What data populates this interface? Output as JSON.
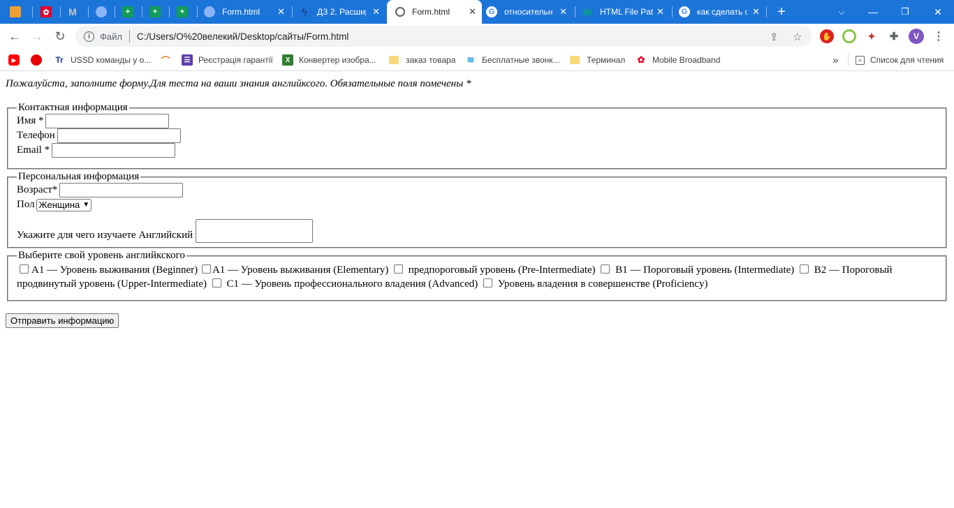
{
  "browser": {
    "tabs": [
      {
        "title": "",
        "icon": "bookmark-favicon",
        "color": "#f0a030",
        "active": false
      },
      {
        "title": "",
        "icon": "huawei-favicon",
        "color": "#e4002b",
        "active": false
      },
      {
        "title": "",
        "icon": "gmail-favicon",
        "color": "#c0c7d6",
        "active": false
      },
      {
        "title": "",
        "icon": "globe-favicon",
        "color": "#8ab4f8",
        "active": false
      },
      {
        "title": "",
        "icon": "plus-green-favicon",
        "color": "#0f9d58",
        "active": false
      },
      {
        "title": "",
        "icon": "plus-green-favicon",
        "color": "#0f9d58",
        "active": false
      },
      {
        "title": "",
        "icon": "plus-green-favicon",
        "color": "#0f9d58",
        "active": false
      },
      {
        "title": "Form.html",
        "icon": "globe-favicon",
        "color": "#8ab4f8",
        "active": false
      },
      {
        "title": "ДЗ 2. Расшир",
        "icon": "lightning-favicon",
        "color": "#1b3f8f",
        "active": false
      },
      {
        "title": "Form.html",
        "icon": "globe-favicon",
        "color": "#5f6368",
        "active": true
      },
      {
        "title": "относительн",
        "icon": "google-favicon",
        "color": "#ffffff",
        "active": false
      },
      {
        "title": "HTML File Pat",
        "icon": "w3schools-favicon",
        "color": "#04aa6d",
        "active": false
      },
      {
        "title": "как сделать с",
        "icon": "google-favicon",
        "color": "#ffffff",
        "active": false
      }
    ],
    "new_tab_label": "+",
    "address": {
      "scheme_label": "Файл",
      "url": "C:/Users/O%20велекий/Desktop/сайты/Form.html"
    },
    "profile_initial": "V",
    "bookmarks": [
      {
        "label": "",
        "icon": "youtube-icon",
        "color": "#ff0000"
      },
      {
        "label": "",
        "icon": "vodafone-icon",
        "color": "#e60000"
      },
      {
        "label": "USSD команды у о...",
        "icon": "tr-icon",
        "color": "#1a3b8c"
      },
      {
        "label": "",
        "icon": "rainbow-icon",
        "color": "#e67e22"
      },
      {
        "label": "Реєстрація гарантії",
        "icon": "list-icon",
        "color": "#5b3fa8"
      },
      {
        "label": "Конвертер изобра...",
        "icon": "x-converter-icon",
        "color": "#2e7d32"
      },
      {
        "label": "заказ товара",
        "icon": "folder-icon",
        "color": "#f9d87a"
      },
      {
        "label": "Бесплатные звонк...",
        "icon": "wifi-icon",
        "color": "#1a9be6"
      },
      {
        "label": "Терминал",
        "icon": "folder-icon",
        "color": "#f9d87a"
      },
      {
        "label": "Mobile Broadband",
        "icon": "huawei-icon",
        "color": "#e4002b"
      }
    ],
    "reading_list_label": "Список для чтения"
  },
  "form": {
    "intro": "Пожалуйста, заполните форму.Для теста на ваши знания английксого. Обязательные поля помечены *",
    "contact": {
      "legend": "Контактная информация",
      "name_label": "Имя *",
      "phone_label": "Телефон",
      "email_label": "Email *"
    },
    "personal": {
      "legend": "Персональная информация",
      "age_label": "Возраст*",
      "gender_label": "Пол",
      "gender_value": "Женщина",
      "purpose_label": "Укажите для чего изучаете Английский"
    },
    "levels": {
      "legend": "Выберите свой уровень английкского",
      "options": [
        "А1 — Уровень выживания (Beginner)",
        "А1 — Уровень выживания (Elementary)",
        "предпороговый уровень (Pre-Intermediate)",
        "В1 — Пороговый уровень (Intermediate)",
        "В2 — Пороговый продвинутый уровень (Upper-Intermediate)",
        "С1 — Уровень профессионального владения (Advanced)",
        "Уровень владения в совершенстве (Proficiency)"
      ]
    },
    "submit_label": "Отправить информацию"
  }
}
